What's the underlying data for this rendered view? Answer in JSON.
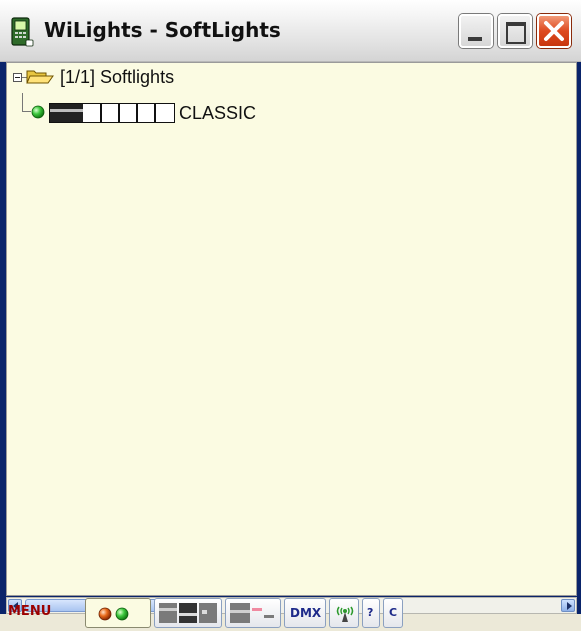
{
  "window": {
    "title": "WiLights - SoftLights"
  },
  "tree": {
    "root": {
      "label": "[1/1] Softlights",
      "expanded": true
    },
    "children": [
      {
        "label": "CLASSIC",
        "status": "online",
        "status_color": "#2db82d"
      }
    ]
  },
  "toolbar": {
    "menu_label": "MENU",
    "dmx_label": "DMX",
    "help_label": "?",
    "c_label": "C"
  },
  "icons": {
    "app": "phone-light-icon",
    "folder": "open-folder-icon",
    "led": "green-led-icon",
    "fader": "fader-bars-icon",
    "status": "red-green-led-icon",
    "layout_a": "layout-panels-icon",
    "layout_b": "layout-fader-icon",
    "wireless": "antenna-icon"
  },
  "colors": {
    "client_background": "#fbfbe2",
    "menu_text": "#9b0000",
    "toolbar_text": "#1e2a8a"
  }
}
